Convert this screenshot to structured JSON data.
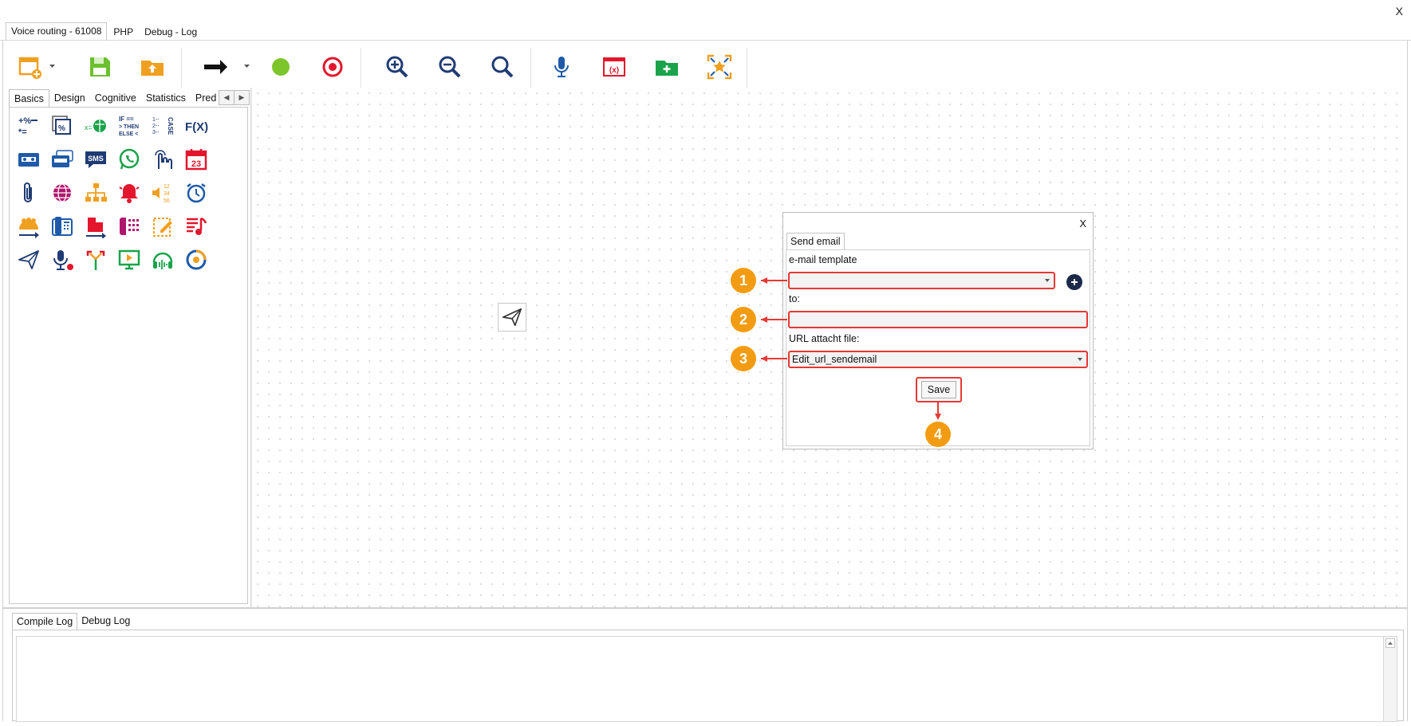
{
  "window": {
    "close_label": "X"
  },
  "top_tabs": [
    "Voice routing - 61008",
    "PHP",
    "Debug - Log"
  ],
  "toolbar": {
    "icons": [
      "new-window-icon",
      "save-icon",
      "upload-folder-icon",
      "arrow-right-icon",
      "green-dot-icon",
      "target-icon",
      "zoom-in-icon",
      "zoom-out-icon",
      "zoom-icon",
      "microphone-icon",
      "variable-icon",
      "add-folder-icon",
      "focus-star-icon"
    ]
  },
  "palette": {
    "tabs": [
      "Basics",
      "Design",
      "Cognitive",
      "Statistics",
      "Pred"
    ],
    "icon_texts": {
      "fx": "F(X)",
      "sms": "SMS",
      "cal": "23",
      "ifthen": "IF ==",
      "case": "CASE"
    }
  },
  "dialog": {
    "close_label": "X",
    "tab": "Send email",
    "email_template_label": "e-mail template",
    "email_template_value": "",
    "to_label": "to:",
    "to_value": "",
    "url_label": "URL attacht file:",
    "url_value": "Edit_url_sendemail",
    "save_label": "Save",
    "badges": [
      "1",
      "2",
      "3",
      "4"
    ]
  },
  "bottom": {
    "tabs": [
      "Compile Log",
      "Debug Log"
    ],
    "log_text": ""
  },
  "colors": {
    "accent_red": "#e53935",
    "badge_orange": "#f39c12",
    "canvas_dot": "#cfcfcf"
  }
}
